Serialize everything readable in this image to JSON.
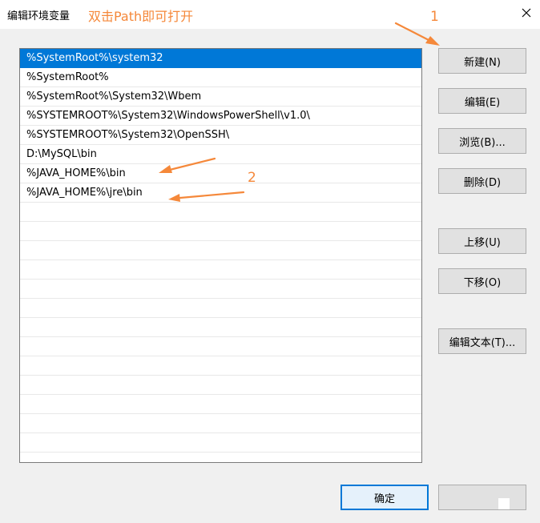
{
  "window": {
    "title": "编辑环境变量",
    "close_icon": "close-icon"
  },
  "annotations": {
    "hint": "双击Path即可打开",
    "marker1": "1",
    "marker2": "2",
    "color": "#f5883a"
  },
  "path_list": {
    "selected_index": 0,
    "items": [
      "%SystemRoot%\\system32",
      "%SystemRoot%",
      "%SystemRoot%\\System32\\Wbem",
      "%SYSTEMROOT%\\System32\\WindowsPowerShell\\v1.0\\",
      "%SYSTEMROOT%\\System32\\OpenSSH\\",
      "D:\\MySQL\\bin",
      "%JAVA_HOME%\\bin",
      "%JAVA_HOME%\\jre\\bin",
      "",
      "",
      "",
      "",
      "",
      "",
      "",
      "",
      "",
      "",
      "",
      "",
      "",
      ""
    ]
  },
  "buttons": {
    "new": "新建(N)",
    "edit": "编辑(E)",
    "browse": "浏览(B)...",
    "delete": "删除(D)",
    "move_up": "上移(U)",
    "move_down": "下移(O)",
    "edit_text": "编辑文本(T)...",
    "ok": "确定",
    "cancel": ""
  },
  "colors": {
    "selection": "#0078d7",
    "annotation": "#f5883a"
  }
}
